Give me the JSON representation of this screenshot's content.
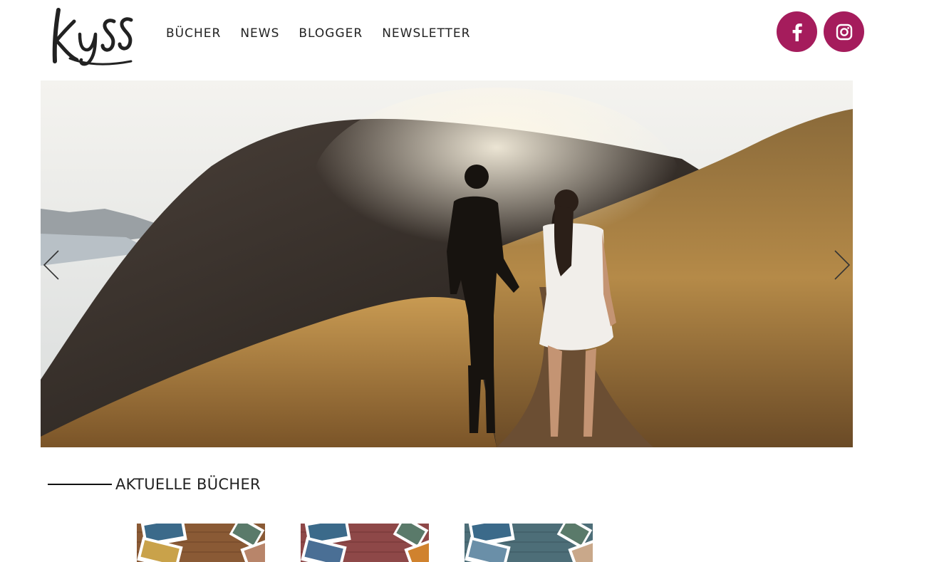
{
  "header": {
    "logo_text": "Kyss",
    "nav": [
      {
        "label": "BÜCHER"
      },
      {
        "label": "NEWS"
      },
      {
        "label": "BLOGGER"
      },
      {
        "label": "NEWSLETTER"
      }
    ],
    "social": [
      {
        "icon": "facebook-icon"
      },
      {
        "icon": "instagram-icon"
      }
    ],
    "accent_color": "#a51c5c"
  },
  "hero": {
    "controls": {
      "prev_icon": "chevron-left-icon",
      "next_icon": "chevron-right-icon"
    }
  },
  "section": {
    "title": "AKTUELLE BÜCHER"
  },
  "books": [
    {
      "tint": "brown"
    },
    {
      "tint": "red"
    },
    {
      "tint": "teal"
    }
  ]
}
